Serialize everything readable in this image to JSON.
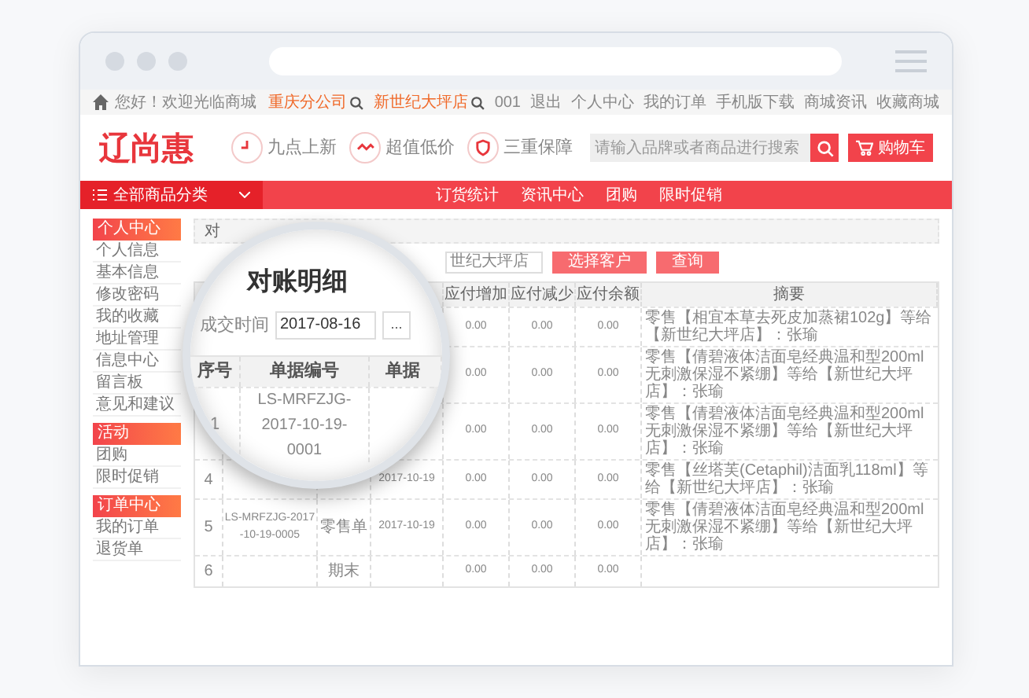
{
  "top_bar": {
    "greeting": "您好！欢迎光临商城",
    "links": [
      {
        "label": "重庆分公司",
        "highlight": true,
        "has_search": true
      },
      {
        "label": "新世纪大坪店",
        "highlight": true,
        "has_search": true
      },
      {
        "label": "001",
        "highlight": false,
        "has_search": false
      },
      {
        "label": "退出",
        "highlight": false,
        "has_search": false
      },
      {
        "label": "个人中心",
        "highlight": false,
        "has_search": false
      },
      {
        "label": "我的订单",
        "highlight": false,
        "has_search": false
      },
      {
        "label": "手机版下载",
        "highlight": false,
        "has_search": false
      },
      {
        "label": "商城资讯",
        "highlight": false,
        "has_search": false
      },
      {
        "label": "收藏商城",
        "highlight": false,
        "has_search": false
      }
    ]
  },
  "header": {
    "logo": "辽尚惠",
    "features": [
      {
        "kind": "clock",
        "label": "九点上新"
      },
      {
        "kind": "price",
        "label": "超值低价"
      },
      {
        "kind": "shield",
        "label": "三重保障"
      }
    ],
    "search": {
      "placeholder": "请输入品牌或者商品进行搜索"
    },
    "cart": "购物车"
  },
  "nav": {
    "category": "全部商品分类",
    "items": [
      "订货统计",
      "资讯中心",
      "团购",
      "限时促销"
    ]
  },
  "sidebar": [
    {
      "title": "个人中心",
      "items": [
        "个人信息",
        "基本信息",
        "修改密码",
        "我的收藏",
        "地址管理",
        "信息中心",
        "留言板",
        "意见和建议"
      ]
    },
    {
      "title": "活动",
      "items": [
        "团购",
        "限时促销"
      ]
    },
    {
      "title": "订单中心",
      "items": [
        "我的订单",
        "退货单"
      ]
    }
  ],
  "breadcrumb": "对",
  "filter": {
    "customer": "世纪大坪店",
    "buttons": [
      "选择客户",
      "查询"
    ]
  },
  "table": {
    "columns": [
      "",
      "",
      "",
      "",
      "应付增加",
      "应付减少",
      "应付余额",
      "摘要"
    ],
    "rows": [
      {
        "increase": "0.00",
        "decrease": "0.00",
        "balance": "0.00",
        "summary": "零售【相宜本草去死皮加蒸裙102g】等给【新世纪大坪店】：张瑜"
      },
      {
        "increase": "0.00",
        "decrease": "0.00",
        "balance": "0.00",
        "summary": "零售【倩碧液体洁面皂经典温和型200ml无刺激保湿不紧绷】等给【新世纪大坪店】：张瑜"
      },
      {
        "increase": "0.00",
        "decrease": "0.00",
        "balance": "0.00",
        "summary": "零售【倩碧液体洁面皂经典温和型200ml无刺激保湿不紧绷】等给【新世纪大坪店】：张瑜"
      },
      {
        "no": "4",
        "date": "2017-10-19",
        "increase": "0.00",
        "decrease": "0.00",
        "balance": "0.00",
        "summary": "零售【丝塔芙(Cetaphil)洁面乳118ml】等给【新世纪大坪店】：张瑜"
      },
      {
        "no": "5",
        "doc_no": "LS-MRFZJG-2017-10-19-0005",
        "doc_type": "零售单",
        "date": "2017-10-19",
        "increase": "0.00",
        "decrease": "0.00",
        "balance": "0.00",
        "summary": "零售【倩碧液体洁面皂经典温和型200ml无刺激保湿不紧绷】等给【新世纪大坪店】：张瑜"
      },
      {
        "no": "6",
        "doc_type": "期末",
        "increase": "0.00",
        "decrease": "0.00",
        "balance": "0.00"
      }
    ]
  },
  "magnifier": {
    "title": "对账明细",
    "date_label": "成交时间",
    "date_value": "2017-08-16",
    "more_button": "...",
    "columns": [
      "序号",
      "单据编号",
      "单据"
    ],
    "row": {
      "no": "1",
      "doc_no": "LS-MRFZJG-2017-10-19-0001"
    }
  }
}
